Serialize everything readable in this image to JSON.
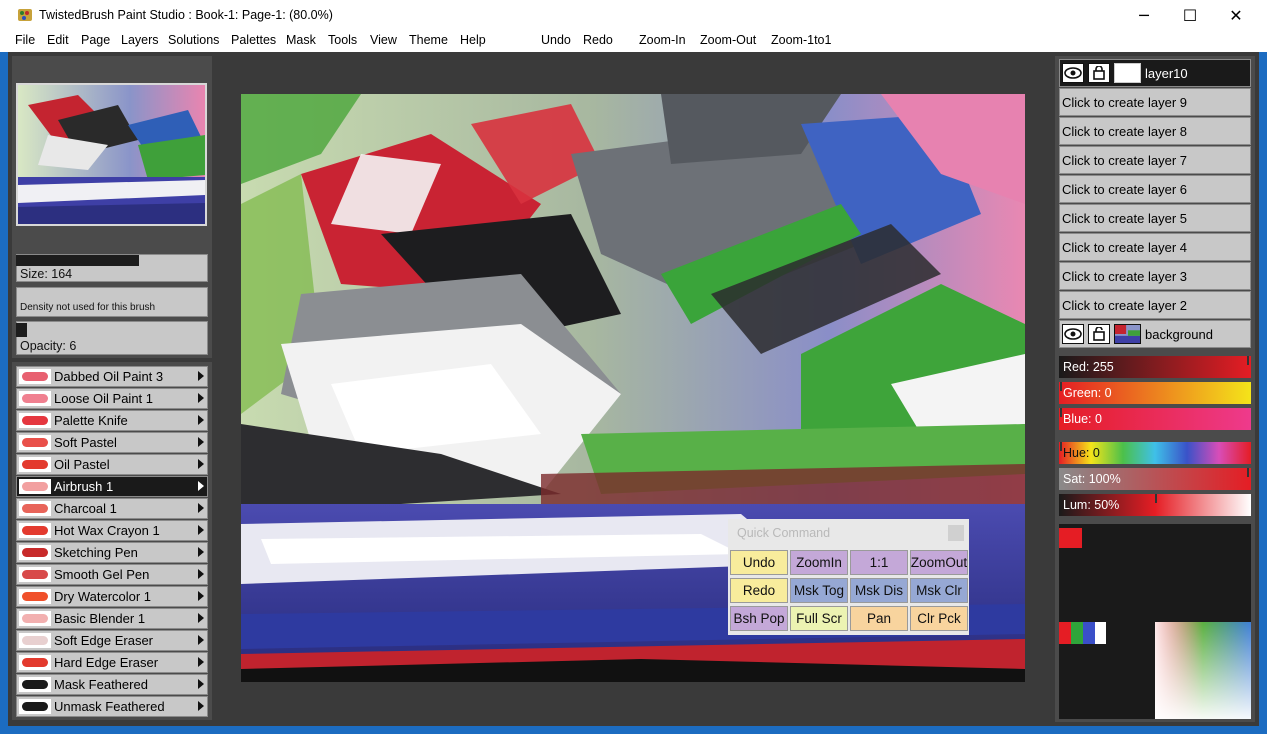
{
  "window": {
    "title": "TwistedBrush Paint Studio : Book-1: Page-1:  (80.0%)",
    "minimize_glyph": "─",
    "maximize_glyph": "☐",
    "close_glyph": "✕"
  },
  "menu": {
    "file": "File",
    "edit": "Edit",
    "page": "Page",
    "layers": "Layers",
    "solutions": "Solutions",
    "palettes": "Palettes",
    "mask": "Mask",
    "tools": "Tools",
    "view": "View",
    "theme": "Theme",
    "help": "Help",
    "undo": "Undo",
    "redo": "Redo",
    "zoom_in": "Zoom-In",
    "zoom_out": "Zoom-Out",
    "zoom_1to1": "Zoom-1to1"
  },
  "brush_settings": {
    "size_label": "Size: 164",
    "size_value": 164,
    "density_text": "Density not used for this brush",
    "opacity_label": "Opacity: 6",
    "opacity_value": 6
  },
  "brushes": [
    {
      "label": "Dabbed Oil Paint 3",
      "selected": false
    },
    {
      "label": "Loose Oil Paint 1",
      "selected": false
    },
    {
      "label": "Palette Knife",
      "selected": false
    },
    {
      "label": "Soft Pastel",
      "selected": false
    },
    {
      "label": "Oil Pastel",
      "selected": false
    },
    {
      "label": "Airbrush 1",
      "selected": true
    },
    {
      "label": "Charcoal 1",
      "selected": false
    },
    {
      "label": "Hot Wax Crayon 1",
      "selected": false
    },
    {
      "label": "Sketching Pen",
      "selected": false
    },
    {
      "label": "Smooth Gel Pen",
      "selected": false
    },
    {
      "label": "Dry Watercolor 1",
      "selected": false
    },
    {
      "label": "Basic Blender 1",
      "selected": false
    },
    {
      "label": "Soft Edge Eraser",
      "selected": false
    },
    {
      "label": "Hard Edge Eraser",
      "selected": false
    },
    {
      "label": "Mask Feathered",
      "selected": false
    },
    {
      "label": "Unmask Feathered",
      "selected": false
    }
  ],
  "quick_command": {
    "title": "Quick Command",
    "buttons": {
      "undo": "Undo",
      "zoom_in": "ZoomIn",
      "one_to_one": "1:1",
      "zoom_out": "ZoomOut",
      "redo": "Redo",
      "msk_tog": "Msk Tog",
      "msk_dis": "Msk Dis",
      "msk_clr": "Msk Clr",
      "bsh_pop": "Bsh Pop",
      "full_scr": "Full Scr",
      "pan": "Pan",
      "clr_pck": "Clr Pck"
    }
  },
  "layers": {
    "top": "layer10",
    "create": [
      "Click to create layer 9",
      "Click to create layer 8",
      "Click to create layer 7",
      "Click to create layer 6",
      "Click to create layer 5",
      "Click to create layer 4",
      "Click to create layer 3",
      "Click to create layer 2"
    ],
    "bottom": "background"
  },
  "color": {
    "red_label": "Red: 255",
    "green_label": "Green: 0",
    "blue_label": "Blue: 0",
    "hue_label": "Hue: 0",
    "sat_label": "Sat: 100%",
    "lum_label": "Lum: 50%",
    "red": 255,
    "green": 0,
    "blue": 0,
    "hue": 0,
    "sat": 100,
    "lum": 50,
    "current_hex": "#e51d24"
  },
  "icons": {
    "app": "twistedbrush-app-icon",
    "visibility": "eye-icon",
    "lock": "lock-icon"
  }
}
